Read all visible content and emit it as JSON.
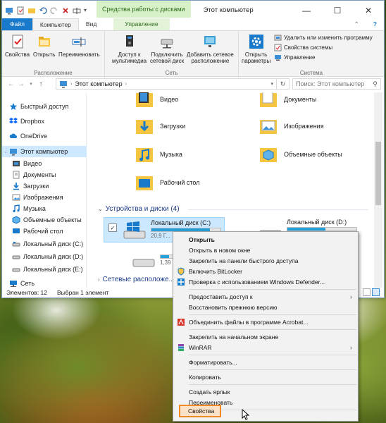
{
  "colors": {
    "file_tab": "#1979ca",
    "context_tab": "#d7f0c8",
    "selection": "#cde8ff",
    "highlight_outline": "#f08a24",
    "folder": "#f5c542"
  },
  "titlebar": {
    "context_label": "Средства работы с дисками",
    "title": "Этот компьютер",
    "minimize_icon": "minimize-icon",
    "maximize_icon": "maximize-icon",
    "close_icon": "close-icon"
  },
  "ribbon_tabs": {
    "file": "Файл",
    "computer": "Компьютер",
    "view": "Вид",
    "manage": "Управление"
  },
  "ribbon": {
    "groups": {
      "location": "Расположение",
      "network": "Сеть",
      "system": "Система"
    },
    "properties": "Свойства",
    "open": "Открыть",
    "rename": "Переименовать",
    "media_access": [
      "Доступ к",
      "мультимедиа"
    ],
    "map_drive": [
      "Подключить",
      "сетевой диск"
    ],
    "add_location": [
      "Добавить сетевое",
      "расположение"
    ],
    "open_settings": [
      "Открыть",
      "параметры"
    ],
    "uninstall": "Удалить или изменить программу",
    "system_props": "Свойства системы",
    "manage": "Управление"
  },
  "address": {
    "path": "Этот компьютер",
    "search_placeholder": "Поиск: Этот компьютер"
  },
  "sidebar": {
    "items": [
      "Быстрый доступ",
      "Dropbox",
      "OneDrive",
      "Этот компьютер",
      "Видео",
      "Документы",
      "Загрузки",
      "Изображения",
      "Музыка",
      "Объемные объекты",
      "Рабочий стол",
      "Локальный диск (C:)",
      "Локальный диск (D:)",
      "Локальный диск (E:)",
      "Сеть"
    ]
  },
  "content": {
    "folders": [
      "Видео",
      "Документы",
      "Загрузки",
      "Изображения",
      "Музыка",
      "Объемные объекты",
      "Рабочий стол"
    ],
    "devices_header": "Устройства и диски (4)",
    "network_header": "Сетевые расположе...",
    "drives": [
      {
        "name": "Локальный диск (C:)",
        "info": "20,9 Г...",
        "used_fraction": 0.85
      },
      {
        "name": "Локальный диск (D:)",
        "info": "",
        "used_fraction": 0.55
      },
      {
        "name": "",
        "info": "1,39 Т...",
        "used_fraction": 0.15
      }
    ]
  },
  "status": {
    "count": "Элементов: 12",
    "selected": "Выбран 1 элемент"
  },
  "context_menu": {
    "open": "Открыть",
    "open_new_window": "Открыть в новом окне",
    "pin_quick": "Закрепить на панели быстрого доступа",
    "bitlocker": "Включить BitLocker",
    "defender": "Проверка с использованием Windows Defender...",
    "give_access": "Предоставить доступ к",
    "restore": "Восстановить прежнюю версию",
    "acrobat": "Объединить файлы в программе Acrobat...",
    "pin_start": "Закрепить на начальном экране",
    "winrar": "WinRAR",
    "format": "Форматировать...",
    "copy": "Копировать",
    "shortcut": "Создать ярлык",
    "rename": "Переименовать",
    "properties": "Свойства"
  }
}
